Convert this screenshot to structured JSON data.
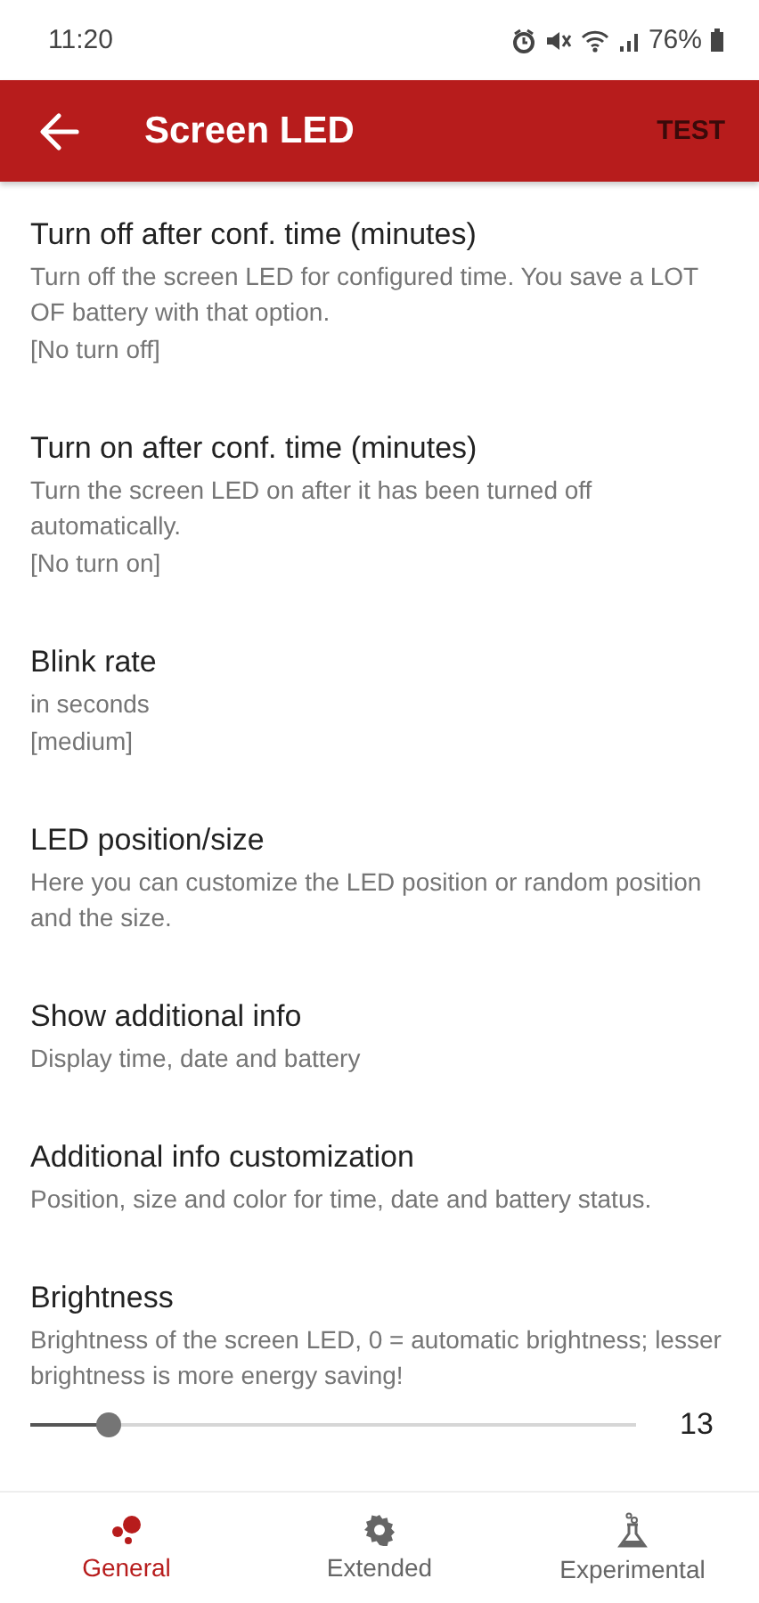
{
  "status_bar": {
    "time": "11:20",
    "battery_text": "76%"
  },
  "app_bar": {
    "title": "Screen LED",
    "action": "TEST"
  },
  "preferences": [
    {
      "kind": "text",
      "title": "Turn off after conf. time (minutes)",
      "summary": "Turn off the screen LED for configured time. You save a LOT OF battery with that option.",
      "value": "[No turn off]"
    },
    {
      "kind": "text",
      "title": "Turn on after conf. time (minutes)",
      "summary": "Turn the screen LED on after it has been turned off automatically.",
      "value": "[No turn on]"
    },
    {
      "kind": "text",
      "title": "Blink rate",
      "summary": "in seconds",
      "value": "[medium]"
    },
    {
      "kind": "text",
      "title": "LED position/size",
      "summary": "Here you can customize the LED position or random position and the size."
    },
    {
      "kind": "text",
      "title": "Show additional info",
      "summary": "Display time, date and battery"
    },
    {
      "kind": "text",
      "title": "Additional info customization",
      "summary": "Position, size and color for time, date and battery status."
    },
    {
      "kind": "slider",
      "title": "Brightness",
      "summary": "Brightness of the screen LED, 0 = automatic brightness; lesser brightness is more energy saving!",
      "level": 0.13,
      "reading": "13"
    }
  ],
  "bottom_nav": [
    {
      "label": "General",
      "kind": "general",
      "selected": true
    },
    {
      "label": "Extended",
      "kind": "extended",
      "selected": false
    },
    {
      "label": "Experimental",
      "kind": "experimental",
      "selected": false
    }
  ]
}
